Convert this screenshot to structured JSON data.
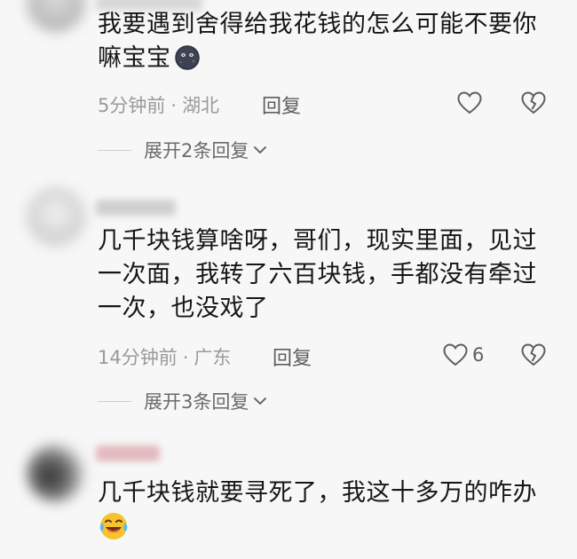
{
  "comments": [
    {
      "text": "我要遇到舍得给我花钱的怎么可能不要你嘛宝宝",
      "time": "5分钟前",
      "location": "湖北",
      "reply_label": "回复",
      "likes": "",
      "emoji": "dark-moon-face-emoji",
      "expand_label": "展开2条回复"
    },
    {
      "text": "几千块钱算啥呀，哥们，现实里面，见过一次面，我转了六百块钱，手都没有牵过一次，也没戏了",
      "time": "14分钟前",
      "location": "广东",
      "reply_label": "回复",
      "likes": "6",
      "expand_label": "展开3条回复"
    },
    {
      "text": "几千块钱就要寻死了，我这十多万的咋办",
      "emoji": "laughing-crying-emoji"
    }
  ],
  "colors": {
    "background": "#f7f7f7",
    "text": "#161616",
    "meta": "#9a9a9a",
    "icon": "#5e5e5e"
  }
}
